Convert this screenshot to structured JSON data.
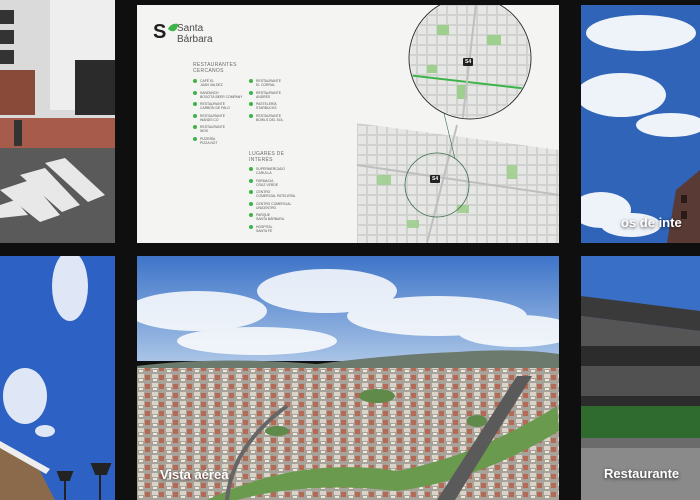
{
  "brand": {
    "mark": "S",
    "name_line1": "Santa",
    "name_line2": "Bárbara",
    "accent": "#3cb44a"
  },
  "map_card": {
    "section1_title": [
      "RESTAURANTES",
      "CERCANOS"
    ],
    "restaurants": [
      "CAFÉ EL\nJUAN VALDEZ",
      "RESTAURANTE\nEL CORRAL",
      "SANDWICH\nBOGOTÁ BEER COMPANY",
      "RESTAURANTE\nANDRÉS",
      "RESTAURANTE\nCARBÓN DE PALO",
      "PASTELERÍA\nSTARBUCKS",
      "RESTAURANTE\nWANDS CO",
      "RESTAURANTE\nBOWLS DEL SOL",
      "RESTAURANTE\nWOK",
      "",
      "PIZZERÍA\nPIZZA NOT",
      ""
    ],
    "section2_title": [
      "LUGARES DE",
      "INTERÉS"
    ],
    "places": [
      "SUPERMERCADO\nCARULLA",
      "FARMACIA\nCRUZ VERDE",
      "CENTRO\nCOMERCIAL PATELERIA",
      "CENTRO COMERCIAL\nUNICENTRO",
      "PARQUE\nSANTA BÁRBARA",
      "HOSPITAL\nSANTA FE"
    ],
    "pin_label": "S4"
  },
  "captions": {
    "top_right": "os de inte",
    "bottom_middle": "Vista aérea",
    "bottom_right": "Restaurante"
  }
}
